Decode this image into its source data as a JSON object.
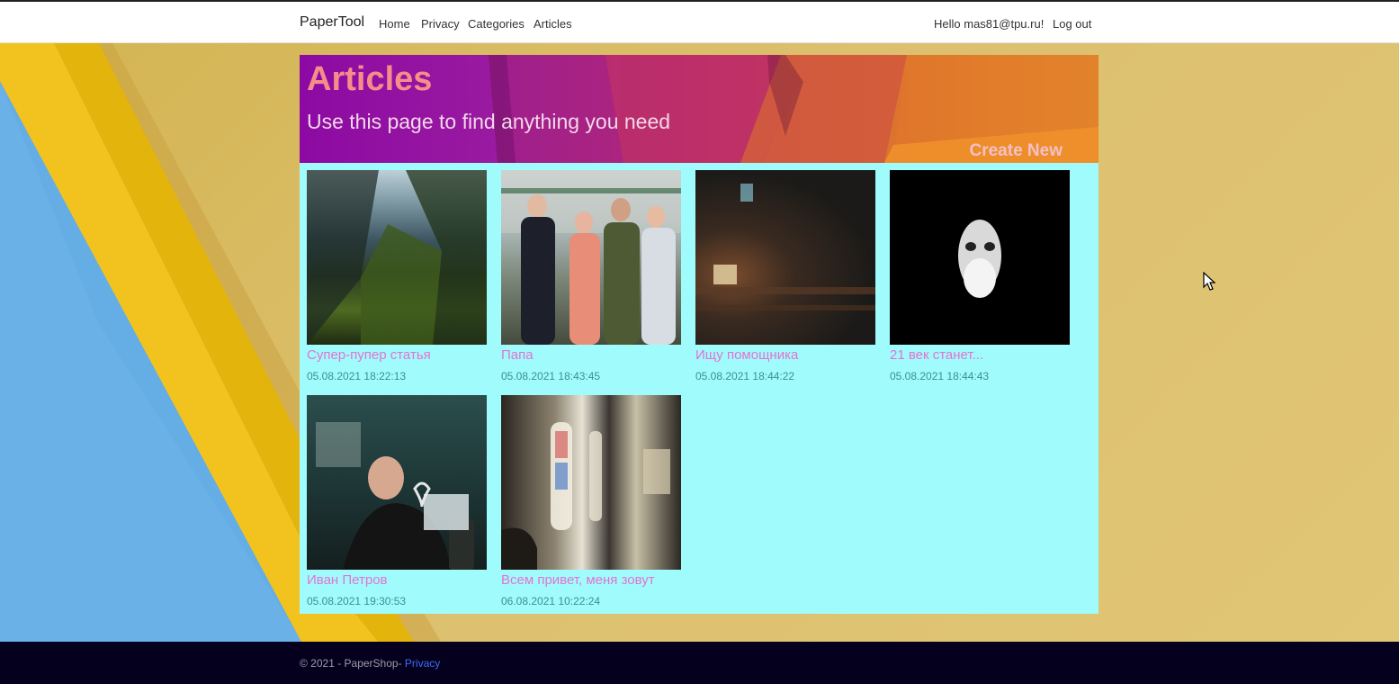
{
  "navbar": {
    "brand": "PaperTool",
    "links": [
      "Home",
      "Privacy",
      "Categories",
      "Articles"
    ],
    "greeting": "Hello mas81@tpu.ru!",
    "logout": "Log out"
  },
  "banner": {
    "title": "Articles",
    "subtitle": "Use this page to find anything you need",
    "create_new": "Create New"
  },
  "articles": [
    {
      "title": "Супер-пупер статья",
      "date": "05.08.2021 18:22:13",
      "thumb": "mountain-valley-photo"
    },
    {
      "title": "Папа",
      "date": "05.08.2021 18:43:45",
      "thumb": "group-of-people-photo"
    },
    {
      "title": "Ищу помощника",
      "date": "05.08.2021 18:44:22",
      "thumb": "dark-room-photo"
    },
    {
      "title": "21 век станет...",
      "date": "05.08.2021 18:44:43",
      "thumb": "face-silhouette-photo"
    },
    {
      "title": "Иван Петров",
      "date": "05.08.2021 19:30:53",
      "thumb": "man-with-heart-photo"
    },
    {
      "title": "Всем привет, меня зовут",
      "date": "06.08.2021 10:22:24",
      "thumb": "church-interior-photo"
    }
  ],
  "footer": {
    "copyright": "© 2021 - PaperShop- ",
    "privacy": "Privacy"
  },
  "colors": {
    "grid_bg": "#a0fcfc",
    "title_pink": "#e472d2",
    "date_teal": "#3a8f8f",
    "footer_bg": "#06001f",
    "footer_link": "#3b6cf5"
  }
}
